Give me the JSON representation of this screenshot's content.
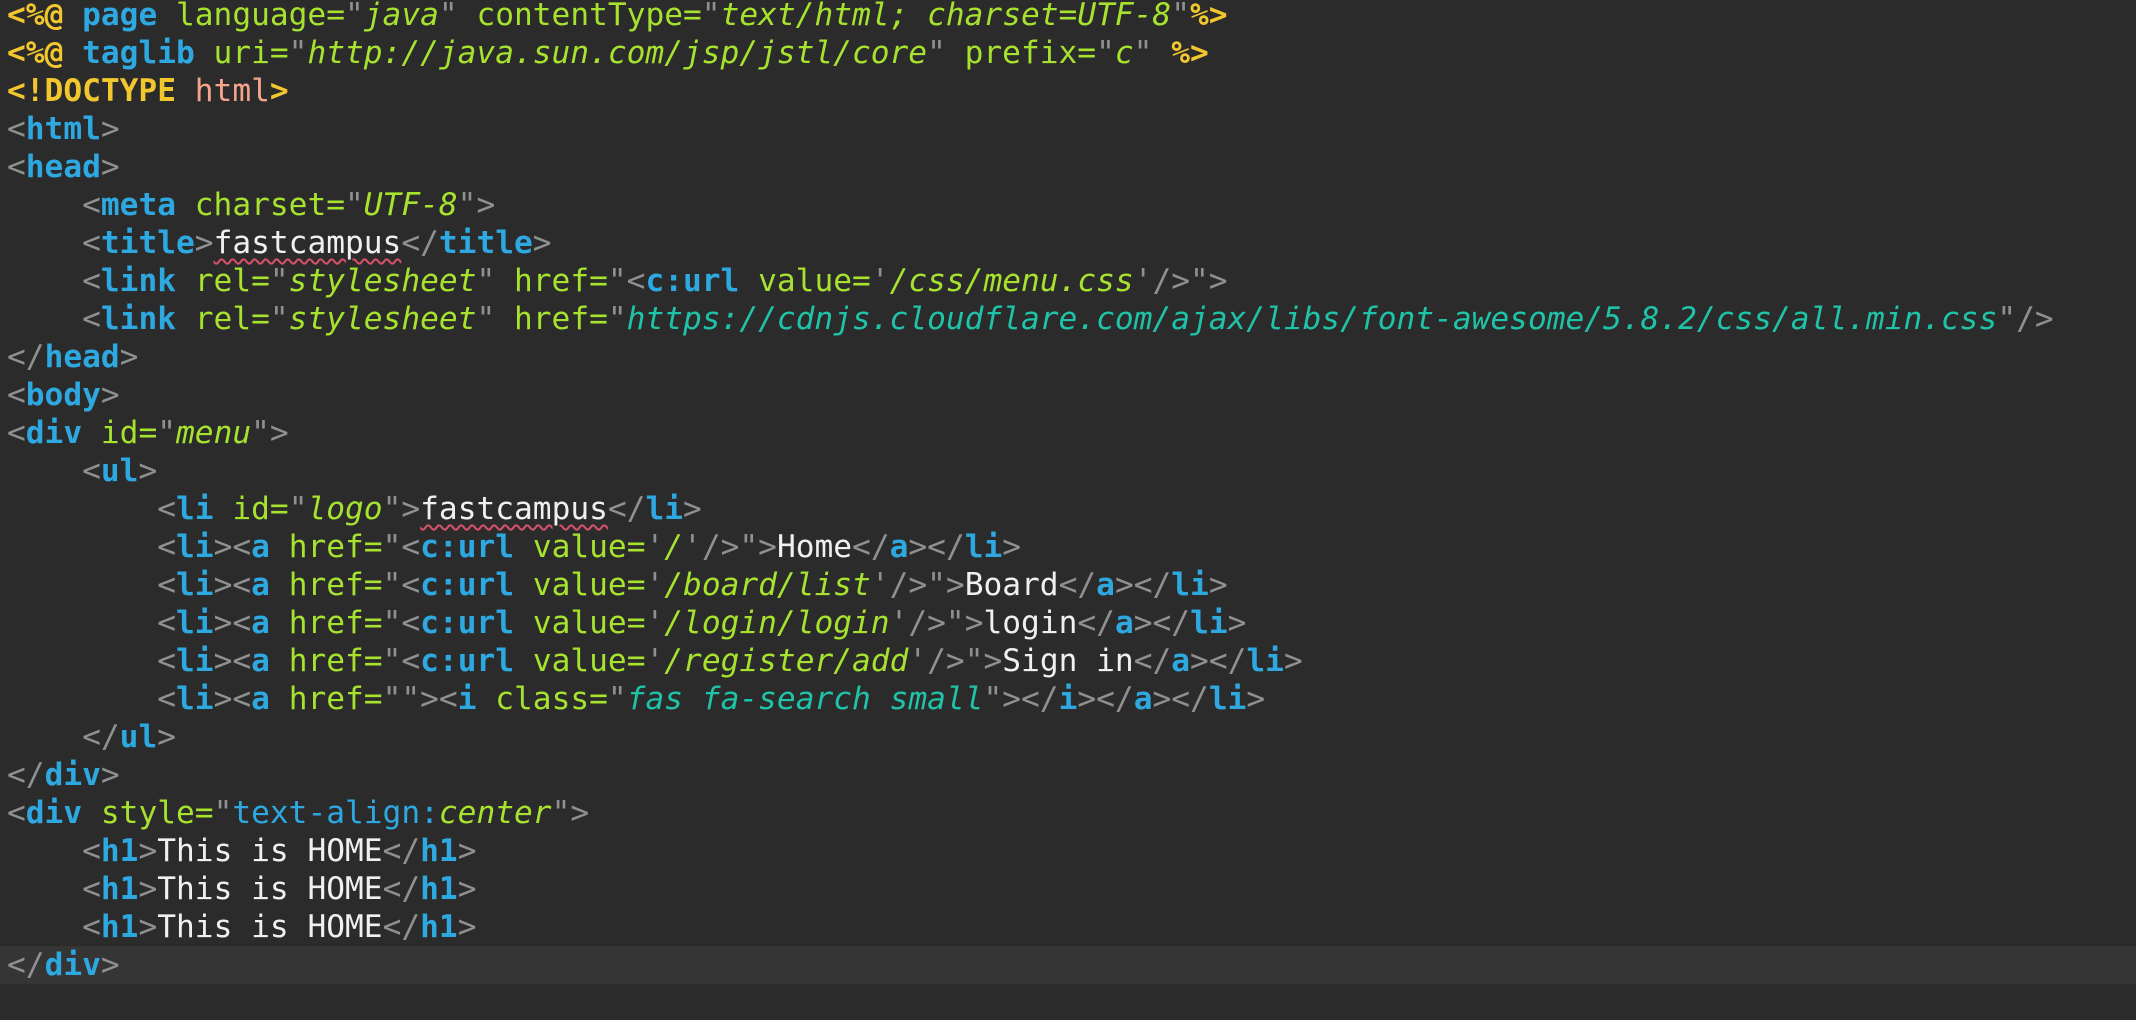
{
  "editor": {
    "lines": [
      [
        [
          "<%@ ",
          "dir"
        ],
        [
          "page ",
          "tag"
        ],
        [
          "language=",
          "attr"
        ],
        [
          "\"",
          "punc"
        ],
        [
          "java",
          "str"
        ],
        [
          "\" ",
          "punc"
        ],
        [
          "contentType=",
          "attr"
        ],
        [
          "\"",
          "punc"
        ],
        [
          "text/html; charset=UTF-8",
          "str"
        ],
        [
          "\"",
          "punc"
        ],
        [
          "%>",
          "dir"
        ]
      ],
      [
        [
          "<%@ ",
          "dir"
        ],
        [
          "taglib ",
          "tag"
        ],
        [
          "uri=",
          "attr"
        ],
        [
          "\"",
          "punc"
        ],
        [
          "http://java.sun.com/jsp/jstl/core",
          "str"
        ],
        [
          "\" ",
          "punc"
        ],
        [
          "prefix=",
          "attr"
        ],
        [
          "\"",
          "punc"
        ],
        [
          "c",
          "str"
        ],
        [
          "\" ",
          "punc"
        ],
        [
          "%>",
          "dir"
        ]
      ],
      [
        [
          "<!DOCTYPE ",
          "doctype"
        ],
        [
          "html",
          "pink"
        ],
        [
          ">",
          "doctype"
        ]
      ],
      [
        [
          "<",
          "punc"
        ],
        [
          "html",
          "tag"
        ],
        [
          ">",
          "punc"
        ]
      ],
      [
        [
          "<",
          "punc"
        ],
        [
          "head",
          "tag"
        ],
        [
          ">",
          "punc"
        ]
      ],
      [
        [
          "    <",
          "punc"
        ],
        [
          "meta ",
          "tag"
        ],
        [
          "charset=",
          "attr"
        ],
        [
          "\"",
          "punc"
        ],
        [
          "UTF-8",
          "str"
        ],
        [
          "\">",
          "punc"
        ]
      ],
      [
        [
          "    <",
          "punc"
        ],
        [
          "title",
          "tag"
        ],
        [
          ">",
          "punc"
        ],
        [
          "fastcampus",
          "spell"
        ],
        [
          "</",
          "punc"
        ],
        [
          "title",
          "tag"
        ],
        [
          ">",
          "punc"
        ]
      ],
      [
        [
          "    <",
          "punc"
        ],
        [
          "link ",
          "tag"
        ],
        [
          "rel=",
          "attr"
        ],
        [
          "\"",
          "punc"
        ],
        [
          "stylesheet",
          "str"
        ],
        [
          "\" ",
          "punc"
        ],
        [
          "href=",
          "attr"
        ],
        [
          "\"<",
          "punc"
        ],
        [
          "c:url ",
          "tag"
        ],
        [
          "value=",
          "attr"
        ],
        [
          "'",
          "punc"
        ],
        [
          "/css/menu.css",
          "str"
        ],
        [
          "'",
          "punc"
        ],
        [
          "/>\">",
          "punc"
        ]
      ],
      [
        [
          "    <",
          "punc"
        ],
        [
          "link ",
          "tag"
        ],
        [
          "rel=",
          "attr"
        ],
        [
          "\"",
          "punc"
        ],
        [
          "stylesheet",
          "str"
        ],
        [
          "\" ",
          "punc"
        ],
        [
          "href=",
          "attr"
        ],
        [
          "\"",
          "punc"
        ],
        [
          "https://cdnjs.cloudflare.com/ajax/libs/font-awesome/5.8.2/css/all.min.css",
          "url"
        ],
        [
          "\"/>",
          "punc"
        ]
      ],
      [
        [
          "</",
          "punc"
        ],
        [
          "head",
          "tag"
        ],
        [
          ">",
          "punc"
        ]
      ],
      [
        [
          "<",
          "punc"
        ],
        [
          "body",
          "tag"
        ],
        [
          ">",
          "punc"
        ]
      ],
      [
        [
          "<",
          "punc"
        ],
        [
          "div ",
          "tag"
        ],
        [
          "id=",
          "attr"
        ],
        [
          "\"",
          "punc"
        ],
        [
          "menu",
          "str"
        ],
        [
          "\">",
          "punc"
        ]
      ],
      [
        [
          "    <",
          "punc"
        ],
        [
          "ul",
          "tag"
        ],
        [
          ">",
          "punc"
        ]
      ],
      [
        [
          "        <",
          "punc"
        ],
        [
          "li ",
          "tag"
        ],
        [
          "id=",
          "attr"
        ],
        [
          "\"",
          "punc"
        ],
        [
          "logo",
          "str"
        ],
        [
          "\">",
          "punc"
        ],
        [
          "fastcampus",
          "spell"
        ],
        [
          "</",
          "punc"
        ],
        [
          "li",
          "tag"
        ],
        [
          ">",
          "punc"
        ]
      ],
      [
        [
          "        <",
          "punc"
        ],
        [
          "li",
          "tag"
        ],
        [
          "><",
          "punc"
        ],
        [
          "a ",
          "tag"
        ],
        [
          "href=",
          "attr"
        ],
        [
          "\"<",
          "punc"
        ],
        [
          "c:url ",
          "tag"
        ],
        [
          "value=",
          "attr"
        ],
        [
          "'",
          "punc"
        ],
        [
          "/",
          "str"
        ],
        [
          "'",
          "punc"
        ],
        [
          "/>\">",
          "punc"
        ],
        [
          "Home",
          "text"
        ],
        [
          "</",
          "punc"
        ],
        [
          "a",
          "tag"
        ],
        [
          "></",
          "punc"
        ],
        [
          "li",
          "tag"
        ],
        [
          ">",
          "punc"
        ]
      ],
      [
        [
          "        <",
          "punc"
        ],
        [
          "li",
          "tag"
        ],
        [
          "><",
          "punc"
        ],
        [
          "a ",
          "tag"
        ],
        [
          "href=",
          "attr"
        ],
        [
          "\"<",
          "punc"
        ],
        [
          "c:url ",
          "tag"
        ],
        [
          "value=",
          "attr"
        ],
        [
          "'",
          "punc"
        ],
        [
          "/board/list",
          "str"
        ],
        [
          "'",
          "punc"
        ],
        [
          "/>\">",
          "punc"
        ],
        [
          "Board",
          "text"
        ],
        [
          "</",
          "punc"
        ],
        [
          "a",
          "tag"
        ],
        [
          "></",
          "punc"
        ],
        [
          "li",
          "tag"
        ],
        [
          ">",
          "punc"
        ]
      ],
      [
        [
          "        <",
          "punc"
        ],
        [
          "li",
          "tag"
        ],
        [
          "><",
          "punc"
        ],
        [
          "a ",
          "tag"
        ],
        [
          "href=",
          "attr"
        ],
        [
          "\"<",
          "punc"
        ],
        [
          "c:url ",
          "tag"
        ],
        [
          "value=",
          "attr"
        ],
        [
          "'",
          "punc"
        ],
        [
          "/login/login",
          "str"
        ],
        [
          "'",
          "punc"
        ],
        [
          "/>\">",
          "punc"
        ],
        [
          "login",
          "text"
        ],
        [
          "</",
          "punc"
        ],
        [
          "a",
          "tag"
        ],
        [
          "></",
          "punc"
        ],
        [
          "li",
          "tag"
        ],
        [
          ">",
          "punc"
        ]
      ],
      [
        [
          "        <",
          "punc"
        ],
        [
          "li",
          "tag"
        ],
        [
          "><",
          "punc"
        ],
        [
          "a ",
          "tag"
        ],
        [
          "href=",
          "attr"
        ],
        [
          "\"<",
          "punc"
        ],
        [
          "c:url ",
          "tag"
        ],
        [
          "value=",
          "attr"
        ],
        [
          "'",
          "punc"
        ],
        [
          "/register/add",
          "str"
        ],
        [
          "'",
          "punc"
        ],
        [
          "/>\">",
          "punc"
        ],
        [
          "Sign in",
          "text"
        ],
        [
          "</",
          "punc"
        ],
        [
          "a",
          "tag"
        ],
        [
          "></",
          "punc"
        ],
        [
          "li",
          "tag"
        ],
        [
          ">",
          "punc"
        ]
      ],
      [
        [
          "        <",
          "punc"
        ],
        [
          "li",
          "tag"
        ],
        [
          "><",
          "punc"
        ],
        [
          "a ",
          "tag"
        ],
        [
          "href=",
          "attr"
        ],
        [
          "\"\"><",
          "punc"
        ],
        [
          "i ",
          "tag"
        ],
        [
          "class=",
          "attr"
        ],
        [
          "\"",
          "punc"
        ],
        [
          "fas fa-search small",
          "url"
        ],
        [
          "\"></",
          "punc"
        ],
        [
          "i",
          "tag"
        ],
        [
          "></",
          "punc"
        ],
        [
          "a",
          "tag"
        ],
        [
          "></",
          "punc"
        ],
        [
          "li",
          "tag"
        ],
        [
          ">",
          "punc"
        ]
      ],
      [
        [
          "    </",
          "punc"
        ],
        [
          "ul",
          "tag"
        ],
        [
          ">",
          "punc"
        ]
      ],
      [
        [
          "</",
          "punc"
        ],
        [
          "div",
          "tag"
        ],
        [
          ">",
          "punc"
        ]
      ],
      [
        [
          "<",
          "punc"
        ],
        [
          "div ",
          "tag"
        ],
        [
          "style=",
          "attr"
        ],
        [
          "\"",
          "punc"
        ],
        [
          "text-align:",
          "cssprop"
        ],
        [
          "center",
          "str"
        ],
        [
          "\">",
          "punc"
        ]
      ],
      [
        [
          "    <",
          "punc"
        ],
        [
          "h1",
          "tag"
        ],
        [
          ">",
          "punc"
        ],
        [
          "This is HOME",
          "text"
        ],
        [
          "</",
          "punc"
        ],
        [
          "h1",
          "tag"
        ],
        [
          ">",
          "punc"
        ]
      ],
      [
        [
          "    <",
          "punc"
        ],
        [
          "h1",
          "tag"
        ],
        [
          ">",
          "punc"
        ],
        [
          "This is HOME",
          "text"
        ],
        [
          "</",
          "punc"
        ],
        [
          "h1",
          "tag"
        ],
        [
          ">",
          "punc"
        ]
      ],
      [
        [
          "    <",
          "punc"
        ],
        [
          "h1",
          "tag"
        ],
        [
          ">",
          "punc"
        ],
        [
          "This is HOME",
          "text"
        ],
        [
          "</",
          "punc"
        ],
        [
          "h1",
          "tag"
        ],
        [
          ">",
          "punc"
        ]
      ],
      [
        [
          "</",
          "punc"
        ],
        [
          "div",
          "tag"
        ],
        [
          ">",
          "punc"
        ]
      ]
    ],
    "current_line": 26
  }
}
